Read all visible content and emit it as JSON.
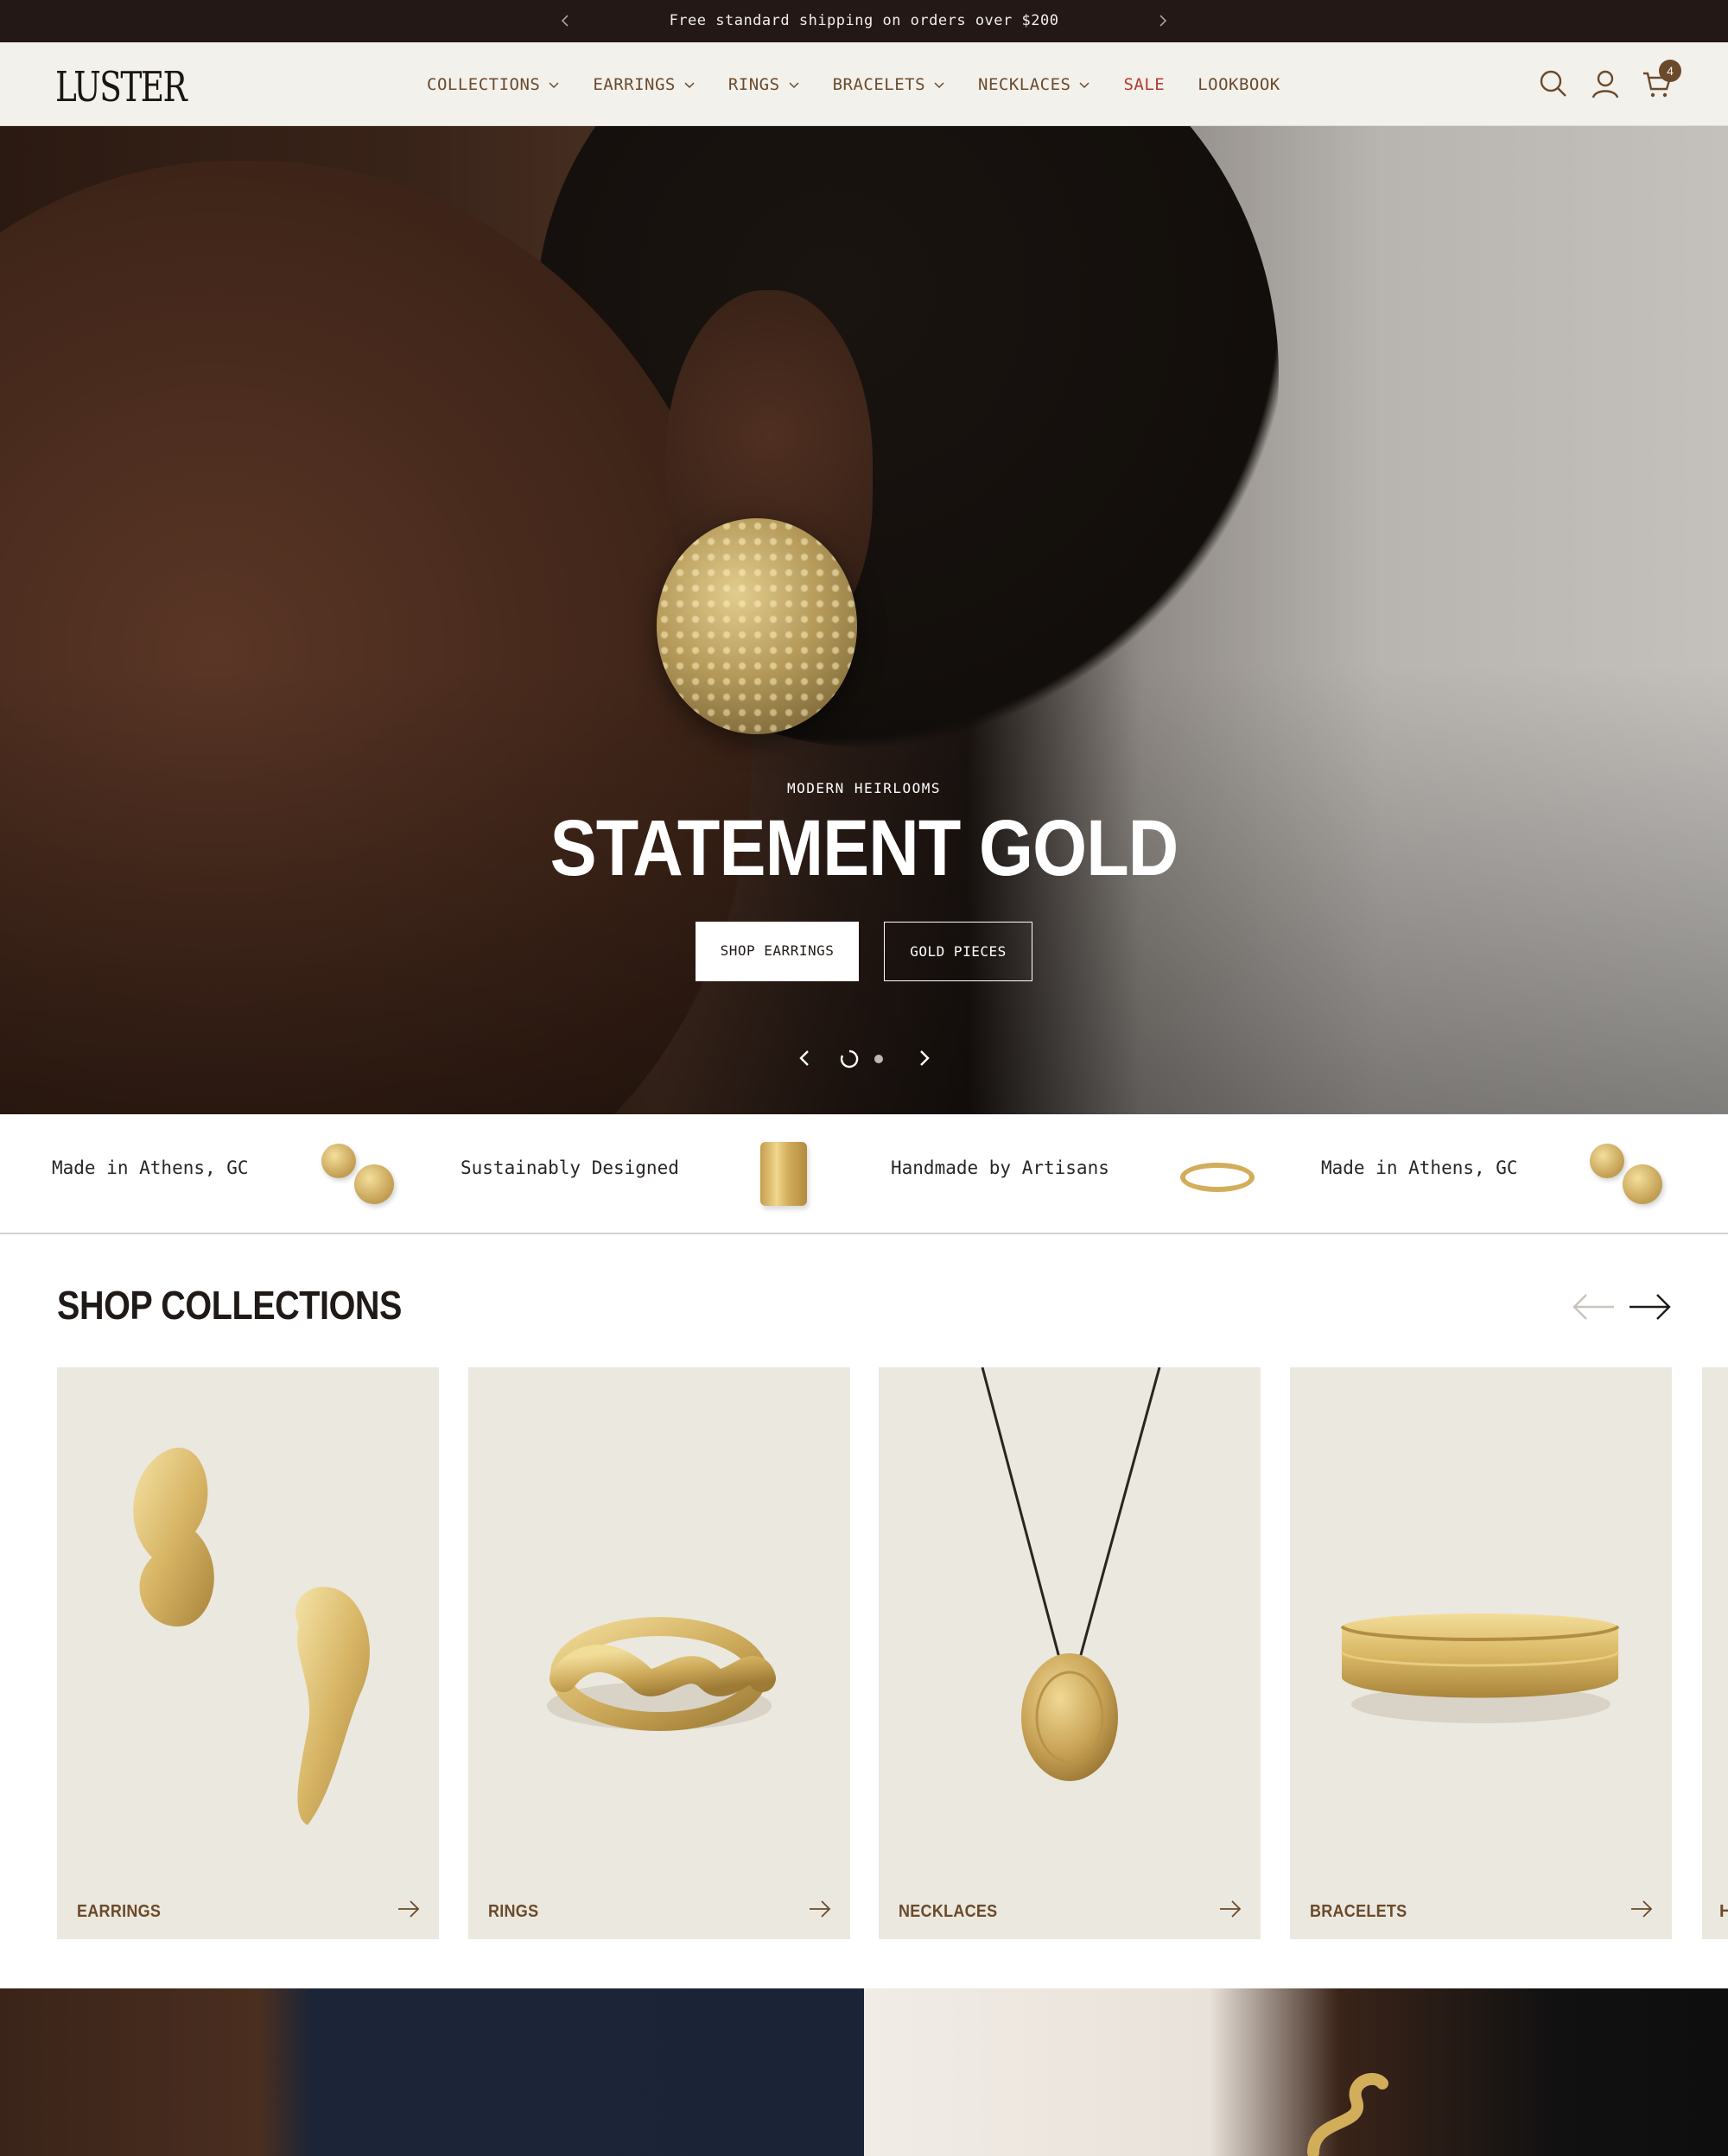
{
  "announcement": {
    "message": "Free standard shipping on orders over $200"
  },
  "header": {
    "logo": "LUSTER",
    "nav": [
      {
        "label": "COLLECTIONS",
        "has_dropdown": true
      },
      {
        "label": "EARRINGS",
        "has_dropdown": true
      },
      {
        "label": "RINGS",
        "has_dropdown": true
      },
      {
        "label": "BRACELETS",
        "has_dropdown": true
      },
      {
        "label": "NECKLACES",
        "has_dropdown": true
      },
      {
        "label": "SALE",
        "has_dropdown": false
      },
      {
        "label": "LOOKBOOK",
        "has_dropdown": false
      }
    ],
    "icons": [
      "search-icon",
      "account-icon",
      "cart-icon"
    ],
    "cart_count": "4"
  },
  "hero": {
    "eyebrow": "MODERN HEIRLOOMS",
    "title": "STATEMENT GOLD",
    "primary_button": "SHOP EARRINGS",
    "secondary_button": "GOLD PIECES",
    "slide_count": 2,
    "active_slide": 1
  },
  "features": [
    {
      "text": "Made in Athens, GC",
      "icon": "stud-earrings-image"
    },
    {
      "text": "Sustainably Designed",
      "icon": "cuff-image"
    },
    {
      "text": "Handmade by Artisans",
      "icon": "ring-image"
    },
    {
      "text": "Made in Athens, GC",
      "icon": "stud-earrings-image"
    }
  ],
  "collections": {
    "title": "SHOP COLLECTIONS",
    "cards": [
      {
        "label": "EARRINGS"
      },
      {
        "label": "RINGS"
      },
      {
        "label": "NECKLACES"
      },
      {
        "label": "BRACELETS"
      }
    ],
    "peek_label": "H"
  },
  "colors": {
    "announcement_bg": "#231815",
    "header_bg": "#f3f1ec",
    "nav_text": "#6b4a2b",
    "sale_text": "#b23a2f",
    "card_bg": "#ebe8df",
    "gold": "#d2ad5a"
  }
}
